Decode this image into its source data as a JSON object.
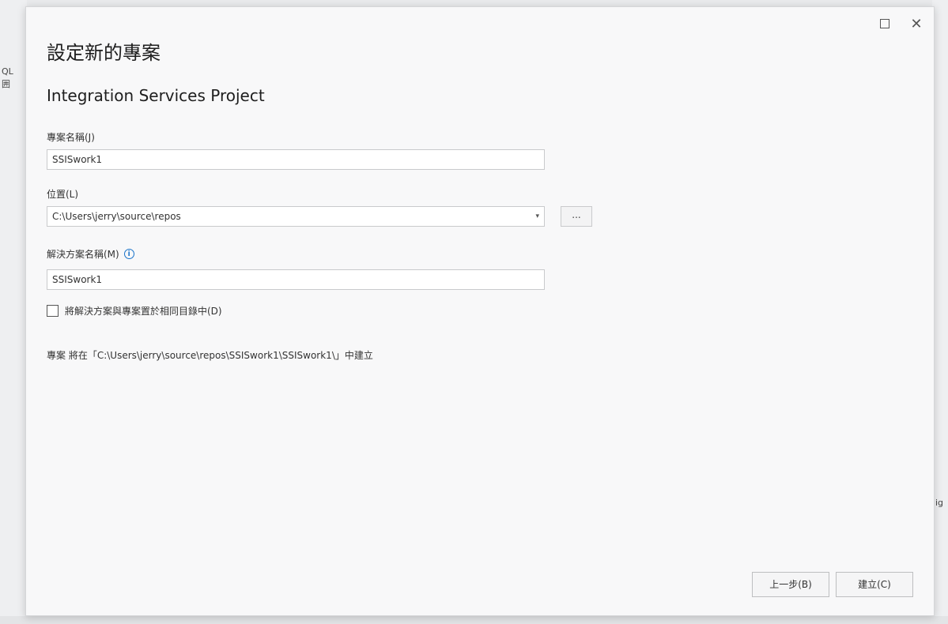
{
  "background": {
    "left_fragments": [
      "QL",
      "囲"
    ],
    "right_fragment": "ig"
  },
  "dialog": {
    "title": "設定新的專案",
    "template_name": "Integration Services Project",
    "window_controls": {
      "maximize_icon": "maximize-icon",
      "close_glyph": "✕"
    },
    "project_name": {
      "label": "專案名稱(J)",
      "value": "SSISwork1"
    },
    "location": {
      "label": "位置(L)",
      "value": "C:\\Users\\jerry\\source\\repos",
      "dropdown_glyph": "▾",
      "browse_label": "..."
    },
    "solution_name": {
      "label": "解決方案名稱(M)",
      "info_glyph": "i",
      "value": "SSISwork1"
    },
    "same_directory": {
      "label": "將解決方案與專案置於相同目錄中(D)",
      "checked": false
    },
    "path_note": "專案 將在「C:\\Users\\jerry\\source\\repos\\SSISwork1\\SSISwork1\\」中建立",
    "buttons": {
      "back": "上一步(B)",
      "create": "建立(C)"
    }
  },
  "colors": {
    "accent": "#1a73c9",
    "dialog_bg": "#f8f8f9",
    "border": "#c9cacc"
  }
}
